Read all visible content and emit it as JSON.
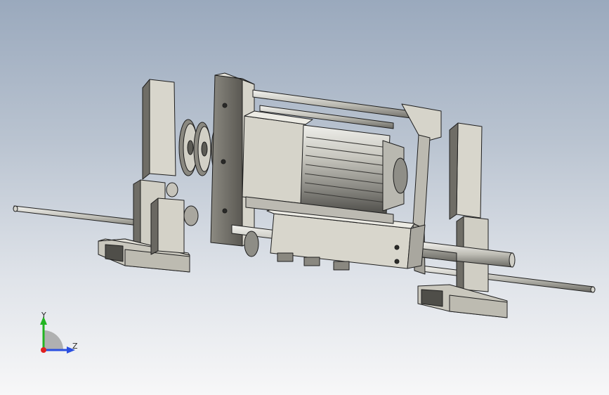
{
  "view": {
    "model_description_hidden": "",
    "colors": {
      "bg_top": "#9aa9bd",
      "bg_bottom": "#f7f7f8",
      "part_light": "#d8d6cc",
      "part_mid": "#b3b1a6",
      "part_dark": "#6c6a62",
      "edge": "#1e1e1e",
      "axis_x": "#e02020",
      "axis_y": "#22b522",
      "axis_z": "#2a4fe0"
    }
  },
  "triad": {
    "y_label": "Y",
    "z_label": "Z",
    "icon": "coordinate-triad-icon"
  }
}
